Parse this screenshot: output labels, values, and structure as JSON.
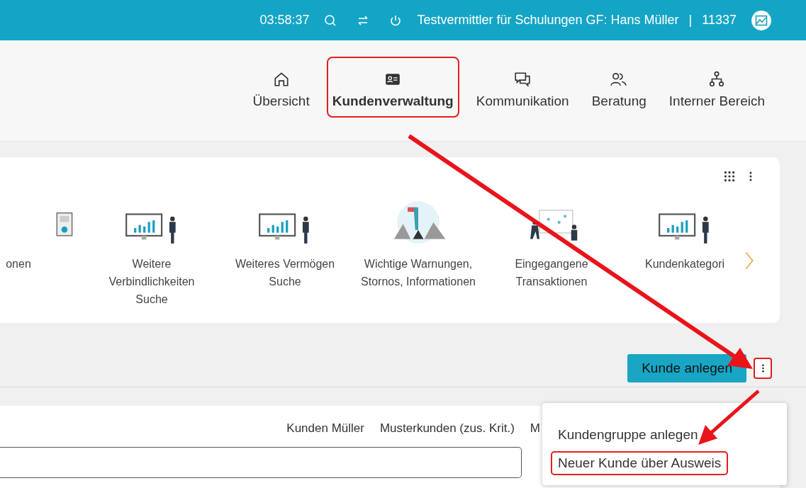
{
  "topbar": {
    "time": "03:58:37",
    "user": "Testvermittler für Schulungen GF: Hans Müller",
    "separator": "|",
    "number": "11337"
  },
  "nav": [
    {
      "label": "Übersicht",
      "kind": "home",
      "selected": false,
      "highlighted": false
    },
    {
      "label": "Kundenverwaltung",
      "kind": "card",
      "selected": true,
      "highlighted": true
    },
    {
      "label": "Kommunikation",
      "kind": "chat",
      "selected": false,
      "highlighted": false
    },
    {
      "label": "Beratung",
      "kind": "people",
      "selected": false,
      "highlighted": false
    },
    {
      "label": "Interner Bereich",
      "kind": "tree",
      "selected": false,
      "highlighted": false
    }
  ],
  "tiles": [
    {
      "label": "onen",
      "kind": "device"
    },
    {
      "label": "Weitere Verbindlichkeiten Suche",
      "kind": "monitor"
    },
    {
      "label": "Weiteres Vermögen Suche",
      "kind": "monitor"
    },
    {
      "label": "Wichtige Warnungen, Stornos, Informationen",
      "kind": "warning"
    },
    {
      "label": "Eingegangene Transaktionen",
      "kind": "transactions"
    },
    {
      "label": "Kundenkategori",
      "kind": "monitor"
    }
  ],
  "actions": {
    "primary_button": "Kunde anlegen",
    "more_button": {
      "highlighted": true
    }
  },
  "menu": [
    {
      "label": "Kundengruppe anlegen",
      "highlighted": false
    },
    {
      "label": "Neuer Kunde über Ausweis",
      "highlighted": true
    }
  ],
  "filters": [
    "Kunden Müller",
    "Musterkunden (zus. Krit.)",
    "M"
  ]
}
